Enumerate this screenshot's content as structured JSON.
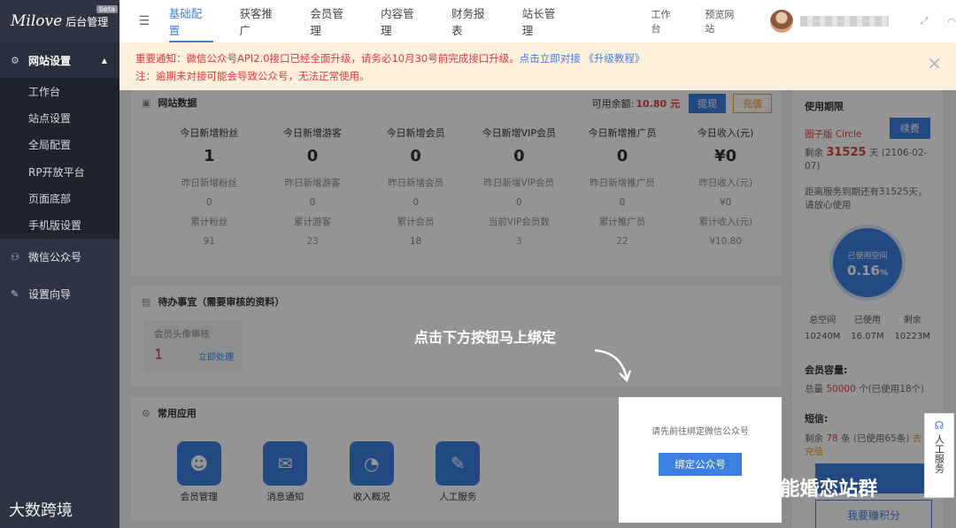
{
  "sidebar": {
    "logo_script": "Milove",
    "logo_admin": "后台管理",
    "badge": "beta",
    "groups": [
      {
        "label": "网站设置",
        "open": true
      },
      {
        "label": "微信公众号"
      },
      {
        "label": "设置向导"
      }
    ],
    "items": [
      "工作台",
      "站点设置",
      "全局配置",
      "RP开放平台",
      "页面底部",
      "手机版设置"
    ]
  },
  "topbar": {
    "tabs": [
      "基础配置",
      "获客推广",
      "会员管理",
      "内容管理",
      "财务报表",
      "站长管理"
    ],
    "active_tab": "基础配置",
    "links": [
      "工作台",
      "预览网站"
    ]
  },
  "notice": {
    "line1_prefix": "重要通知：微信公众号API2.0接口已经全面升级，请务必10月30号前完成接口升级。",
    "line1_link": "点击立即对接 《升级教程》",
    "line2": "注：逾期未对接可能会导致公众号，无法正常使用。"
  },
  "site_data": {
    "title": "网站数据",
    "balance_label": "可用余额:",
    "balance_value": "10.80 元",
    "withdraw": "提现",
    "recharge": "充值",
    "stats": [
      {
        "label": "今日新增粉丝",
        "value": "1",
        "ylabel": "昨日新增粉丝",
        "yvalue": "0",
        "tlabel": "累计粉丝",
        "tvalue": "91"
      },
      {
        "label": "今日新增游客",
        "value": "0",
        "ylabel": "昨日新增游客",
        "yvalue": "0",
        "tlabel": "累计游客",
        "tvalue": "23"
      },
      {
        "label": "今日新增会员",
        "value": "0",
        "ylabel": "昨日新增会员",
        "yvalue": "0",
        "tlabel": "累计会员",
        "tvalue": "18"
      },
      {
        "label": "今日新增VIP会员",
        "value": "0",
        "ylabel": "昨日新增VIP会员",
        "yvalue": "0",
        "tlabel": "当前VIP会员数",
        "tvalue": "3"
      },
      {
        "label": "今日新增推广员",
        "value": "0",
        "ylabel": "昨日新增推广员",
        "yvalue": "0",
        "tlabel": "累计推广员",
        "tvalue": "22"
      },
      {
        "label": "今日收入(元)",
        "value": "¥0",
        "ylabel": "昨日收入(元)",
        "yvalue": "¥0",
        "tlabel": "累计收入(元)",
        "tvalue": "¥10.80"
      }
    ]
  },
  "todo": {
    "title": "待办事宜（需要审核的资料）",
    "box_label": "会员头像审核",
    "box_value": "1",
    "box_action": "立即处理"
  },
  "apps": {
    "title": "常用应用",
    "items": [
      {
        "label": "会员管理",
        "icon": "users-icon"
      },
      {
        "label": "消息通知",
        "icon": "chat-icon"
      },
      {
        "label": "收入概况",
        "icon": "pie-chart-icon"
      },
      {
        "label": "人工服务",
        "icon": "wrench-icon"
      }
    ]
  },
  "usage": {
    "title": "使用期限",
    "edition": "圈子版 Circle",
    "renew": "续费",
    "remain_prefix": "剩余",
    "remain_days": "31525",
    "remain_suffix": "天",
    "expire_date": "(2106-02-07)",
    "service_note": "距离服务到期还有31525天，请放心使用",
    "space_label": "已使用空间",
    "space_value": "0.16",
    "space_unit": "%",
    "space_cols": [
      {
        "label": "总空间",
        "value": "10240M"
      },
      {
        "label": "已使用",
        "value": "16.07M"
      },
      {
        "label": "剩余",
        "value": "10223M"
      }
    ],
    "capacity_title": "会员容量:",
    "capacity_prefix": "总量",
    "capacity_value": "50000",
    "capacity_suffix": "个(已使用18个)",
    "sms_title": "短信:",
    "sms_prefix": "剩余",
    "sms_value": "78",
    "sms_suffix": "条 (已使用65条)",
    "sms_link": "去充值",
    "earn_points": "我要赚积分"
  },
  "overlay": {
    "tip": "点击下方按钮马上绑定",
    "modal_text": "请先前往绑定微信公众号",
    "modal_button": "绑定公众号"
  },
  "service_float": "人工服务",
  "watermarks": {
    "left": "大数跨境",
    "right": "@ESNS智能婚恋站群"
  }
}
